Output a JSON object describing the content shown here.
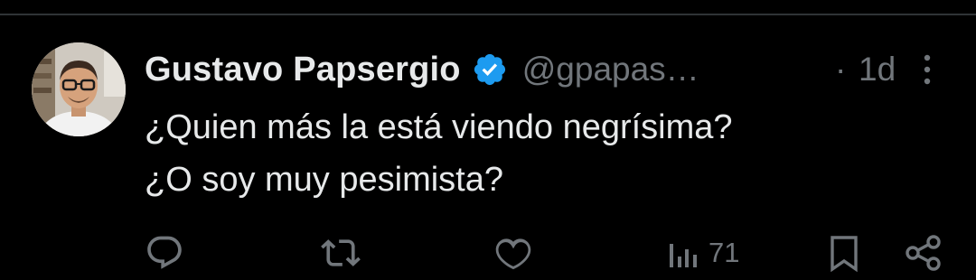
{
  "tweet": {
    "author_name": "Gustavo Papsergio",
    "handle": "@gpapas…",
    "separator": "·",
    "time": "1d",
    "verified": true,
    "text_lines": [
      "¿Quien más la está viendo negrísima?",
      "¿O soy muy pesimista?"
    ]
  },
  "actions": {
    "reply_icon": "speech-bubble-icon",
    "retweet_icon": "repost-arrows-icon",
    "like_icon": "heart-icon",
    "views_icon": "bar-chart-icon",
    "views_count": "71",
    "bookmark_icon": "bookmark-icon",
    "share_icon": "share-nodes-icon"
  },
  "colors": {
    "background": "#000000",
    "primary_text": "#e7e9ea",
    "secondary_text": "#71767b",
    "verified_blue": "#1d9bf0",
    "divider": "#2f3336"
  }
}
